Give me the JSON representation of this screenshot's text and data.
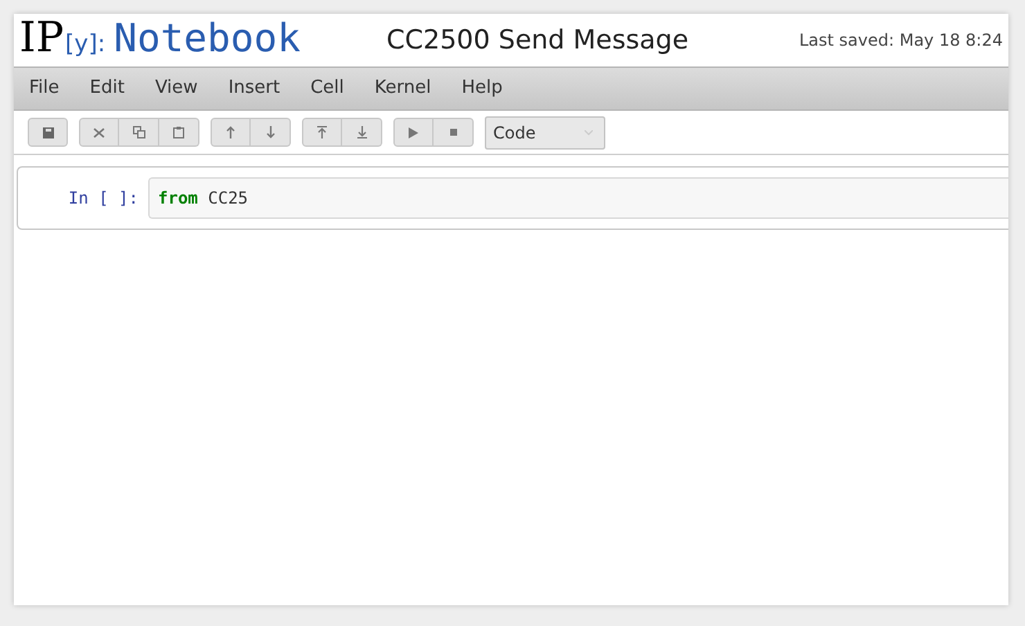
{
  "header": {
    "logo_mark": "IP",
    "logo_bracket": "[y]:",
    "logo_text": "Notebook",
    "notebook_name": "CC2500 Send Message",
    "last_saved": "Last saved: May 18 8:24"
  },
  "menu": [
    "File",
    "Edit",
    "View",
    "Insert",
    "Cell",
    "Kernel",
    "Help"
  ],
  "toolbar": {
    "cell_type": "Code"
  },
  "cells": [
    {
      "prompt": "In [ ]:",
      "tokens": [
        {
          "kind": "keyword",
          "text": "from"
        },
        {
          "kind": "name",
          "text": "CC25"
        }
      ]
    }
  ]
}
